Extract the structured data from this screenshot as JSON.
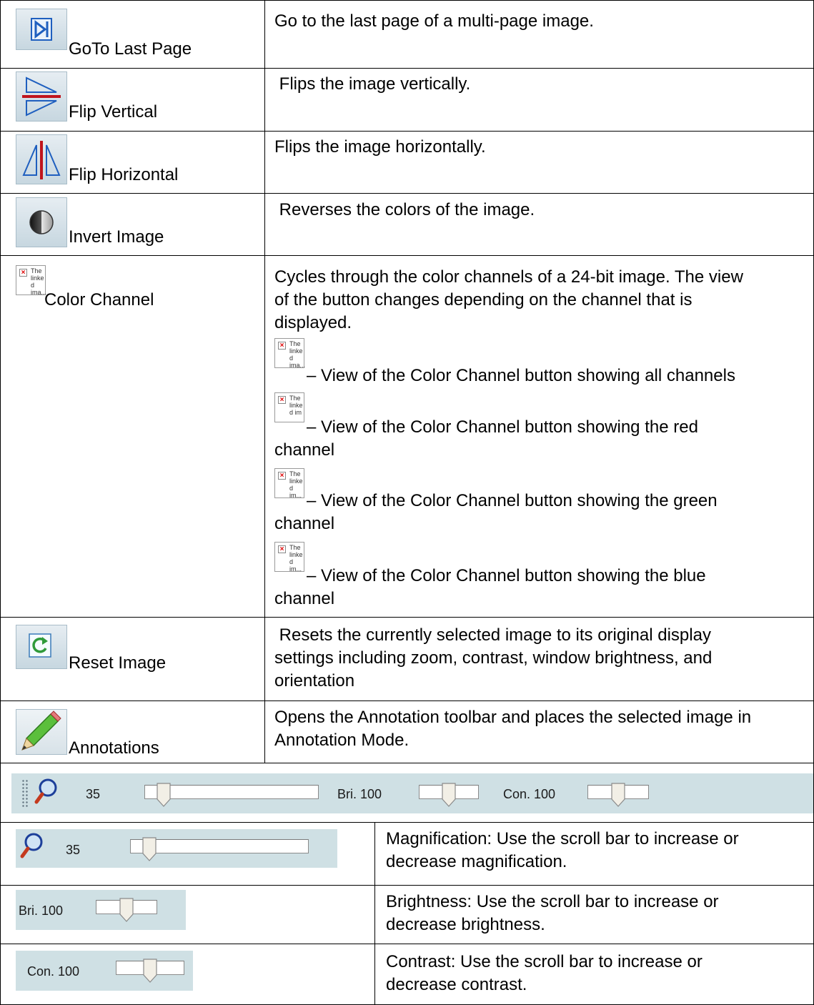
{
  "rows": [
    {
      "icon": "goto-last-page-icon",
      "label": "GoTo Last Page",
      "description": [
        "Go to the last page of a multi-page image."
      ]
    },
    {
      "icon": "flip-vertical-icon",
      "label": "Flip Vertical",
      "description": [
        " Flips the image vertically."
      ]
    },
    {
      "icon": "flip-horizontal-icon",
      "label": "Flip Horizontal",
      "description": [
        "Flips the image horizontally."
      ]
    },
    {
      "icon": "invert-image-icon",
      "label": "Invert Image",
      "description": [
        " Reverses the colors of the image."
      ]
    },
    {
      "icon": "broken-image-icon",
      "label": "Color Channel",
      "description": [
        "Cycles through the color channels of a 24-bit image. The view",
        "of the button changes depending on the channel that is",
        "displayed."
      ],
      "channel_views": [
        {
          "line1": "– View of the Color Channel button showing all channels",
          "line2": "",
          "img_text": "The linke d ima..."
        },
        {
          "line1": "– View of the Color Channel button showing the red",
          "line2": "channel",
          "img_text": "The linke d im"
        },
        {
          "line1": "– View of the Color Channel button showing the green",
          "line2": "channel",
          "img_text": "The linke d im..."
        },
        {
          "line1": "– View of the Color Channel button showing the blue",
          "line2": "channel",
          "img_text": "The linke d im..."
        }
      ],
      "icon_img_text": "The linke d ima..."
    },
    {
      "icon": "reset-image-icon",
      "label": "Reset Image",
      "description": [
        " Resets the currently selected image to its original display",
        "settings including zoom, contrast, window brightness, and",
        "orientation"
      ]
    },
    {
      "icon": "pencil-icon",
      "label": "Annotations",
      "description": [
        "Opens the Annotation toolbar and places the selected image in",
        "Annotation Mode."
      ]
    }
  ],
  "toolbar": {
    "zoom_value": "35",
    "bri_label": "Bri. 100",
    "con_label": "Con. 100",
    "zoom_level": 0.07,
    "bri_level": 0.5,
    "con_level": 0.5
  },
  "sliders": [
    {
      "control_text": "35",
      "description": [
        "Magnification: Use the scroll bar to increase or",
        "decrease magnification."
      ]
    },
    {
      "control_text": "Bri. 100",
      "description": [
        "Brightness: Use the scroll bar to increase or",
        "decrease brightness."
      ]
    },
    {
      "control_text": "Con. 100",
      "description": [
        "Contrast: Use the scroll bar to increase or",
        "decrease contrast."
      ]
    }
  ],
  "colors": {
    "button_face": "#d8e4ea",
    "toolbar_bg": "#cfe0e4",
    "icon_blue": "#1f5fbf",
    "icon_red": "#c0141c"
  }
}
